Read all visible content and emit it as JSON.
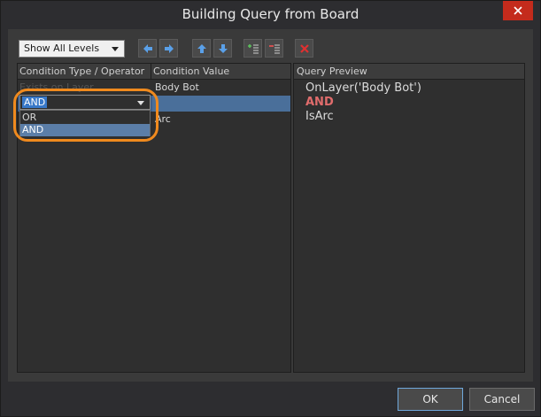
{
  "window": {
    "title": "Building Query from Board"
  },
  "toolbar": {
    "levels_select": "Show All Levels",
    "buttons": [
      {
        "name": "move-left-icon",
        "color": "#5aa0e8"
      },
      {
        "name": "move-right-icon",
        "color": "#5aa0e8"
      },
      {
        "name": "move-up-icon",
        "color": "#5aa0e8"
      },
      {
        "name": "move-down-icon",
        "color": "#5aa0e8"
      },
      {
        "name": "add-condition-icon",
        "color": "#5cc05c"
      },
      {
        "name": "remove-condition-icon",
        "color": "#e05050"
      },
      {
        "name": "delete-icon",
        "color": "#e03030"
      }
    ]
  },
  "grid": {
    "headers": [
      "Condition Type / Operator",
      "Condition Value"
    ],
    "rows": [
      {
        "type": "Exists on Layer",
        "value": "Body Bot"
      },
      {
        "type": "AND",
        "value": ""
      },
      {
        "type": "",
        "value": "Arc"
      }
    ],
    "operator_combo": {
      "selected": "AND",
      "options": [
        "OR",
        "AND"
      ]
    }
  },
  "preview": {
    "header": "Query Preview",
    "lines": [
      {
        "text": "OnLayer('Body Bot')",
        "kind": "expr"
      },
      {
        "text": "AND",
        "kind": "keyword"
      },
      {
        "text": "IsArc",
        "kind": "expr"
      }
    ]
  },
  "buttons": {
    "ok": "OK",
    "cancel": "Cancel"
  },
  "colors": {
    "accent": "#3878c8",
    "highlight_ring": "#f08a1e",
    "keyword": "#e06c6c",
    "close": "#c42b1c"
  }
}
